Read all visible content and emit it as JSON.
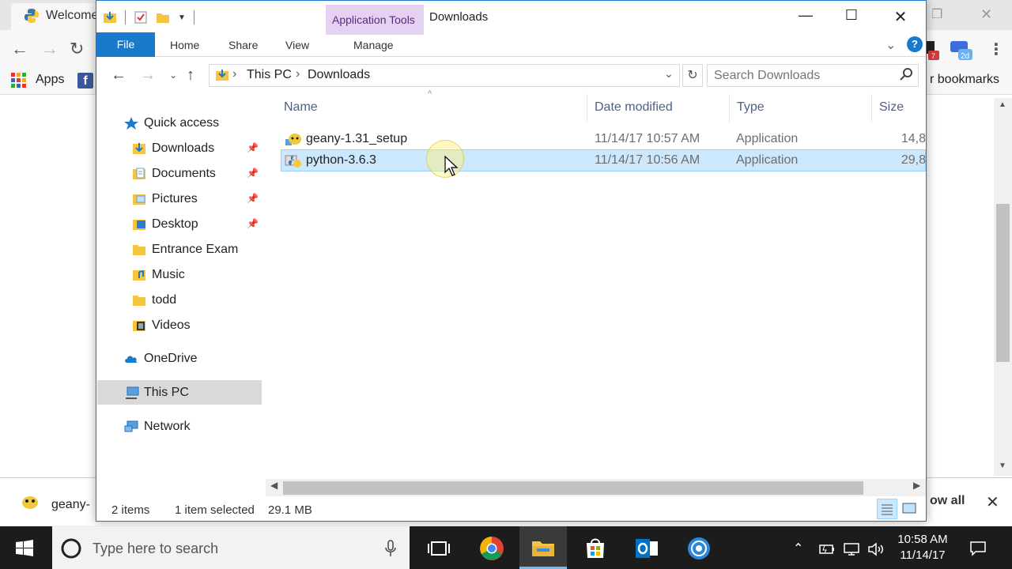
{
  "chrome": {
    "tab_title": "Welcome",
    "apps_label": "Apps",
    "bookmarks_right": "r bookmarks",
    "ext_badge_1": "7",
    "ext_badge_2": "2d",
    "download_name": "geany-",
    "show_all": "ow all"
  },
  "explorer": {
    "title": "Downloads",
    "context_tab": "Application Tools",
    "ribbon_tabs": {
      "file": "File",
      "home": "Home",
      "share": "Share",
      "view": "View",
      "manage": "Manage"
    },
    "breadcrumb": [
      "This PC",
      "Downloads"
    ],
    "search_placeholder": "Search Downloads",
    "nav": {
      "quick_access": "Quick access",
      "quick_items": [
        {
          "label": "Downloads",
          "pinned": true,
          "icon": "downloads-folder-icon"
        },
        {
          "label": "Documents",
          "pinned": true,
          "icon": "documents-folder-icon"
        },
        {
          "label": "Pictures",
          "pinned": true,
          "icon": "pictures-folder-icon"
        },
        {
          "label": "Desktop",
          "pinned": true,
          "icon": "desktop-folder-icon"
        },
        {
          "label": "Entrance Exam",
          "pinned": false,
          "icon": "folder-icon"
        },
        {
          "label": "Music",
          "pinned": false,
          "icon": "music-folder-icon"
        },
        {
          "label": "todd",
          "pinned": false,
          "icon": "folder-icon"
        },
        {
          "label": "Videos",
          "pinned": false,
          "icon": "videos-folder-icon"
        }
      ],
      "onedrive": "OneDrive",
      "this_pc": "This PC",
      "network": "Network"
    },
    "columns": {
      "name": "Name",
      "date": "Date modified",
      "type": "Type",
      "size": "Size"
    },
    "files": [
      {
        "name": "geany-1.31_setup",
        "date": "11/14/17 10:57 AM",
        "type": "Application",
        "size": "14,8",
        "selected": false
      },
      {
        "name": "python-3.6.3",
        "date": "11/14/17 10:56 AM",
        "type": "Application",
        "size": "29,8",
        "selected": true
      }
    ],
    "status": {
      "count": "2 items",
      "selected": "1 item selected",
      "size": "29.1 MB"
    }
  },
  "taskbar": {
    "search_placeholder": "Type here to search",
    "time": "10:58 AM",
    "date": "11/14/17"
  },
  "colors": {
    "accent": "#1979ca",
    "selection": "#cce8ff",
    "context_tab": "#e5d2f3",
    "taskbar": "#1c1c1c"
  }
}
